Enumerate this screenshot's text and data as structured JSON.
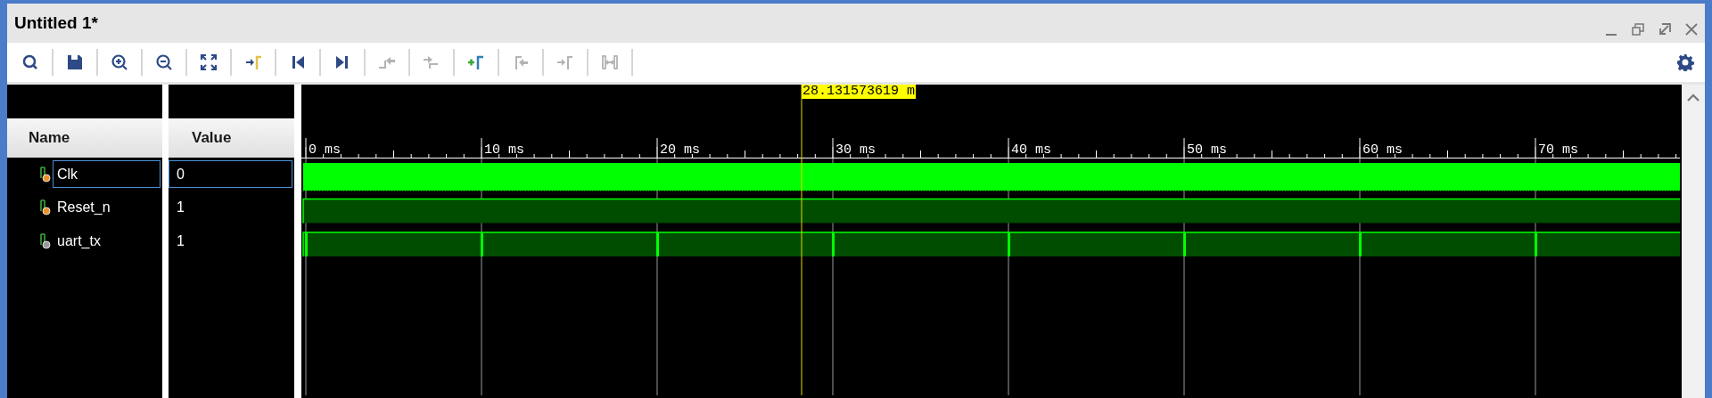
{
  "window": {
    "title": "Untitled 1*"
  },
  "window_controls": [
    {
      "kind": "minimize"
    },
    {
      "kind": "restore"
    },
    {
      "kind": "float"
    },
    {
      "kind": "close"
    }
  ],
  "toolbar": [
    {
      "kind": "zoom-fit",
      "disabled": false
    },
    {
      "kind": "save",
      "disabled": false
    },
    {
      "kind": "zoom-in",
      "disabled": false
    },
    {
      "kind": "zoom-out",
      "disabled": false
    },
    {
      "kind": "full-view",
      "disabled": false
    },
    {
      "kind": "go-to-cursor",
      "disabled": false
    },
    {
      "kind": "go-to-start",
      "disabled": false
    },
    {
      "kind": "go-to-end",
      "disabled": false
    },
    {
      "kind": "prev-transition",
      "disabled": true
    },
    {
      "kind": "next-transition",
      "disabled": true
    },
    {
      "kind": "add-marker",
      "disabled": false
    },
    {
      "kind": "prev-marker",
      "disabled": true
    },
    {
      "kind": "next-marker",
      "disabled": true
    },
    {
      "kind": "swap-cursors",
      "disabled": true
    }
  ],
  "columns": [
    "Name",
    "Value"
  ],
  "cursor": {
    "label": "28.131573619 m"
  },
  "time_ticks": [
    "0 ms",
    "10 ms",
    "20 ms",
    "30 ms",
    "40 ms",
    "50 ms",
    "60 ms",
    "70 ms"
  ],
  "signals": [
    {
      "name": "Clk",
      "value": "0",
      "output": false,
      "kind": "clock",
      "selected": true
    },
    {
      "name": "Reset_n",
      "value": "1",
      "output": false,
      "kind": "high",
      "selected": false
    },
    {
      "name": "uart_tx",
      "value": "1",
      "output": true,
      "kind": "toggling",
      "selected": false
    }
  ]
}
